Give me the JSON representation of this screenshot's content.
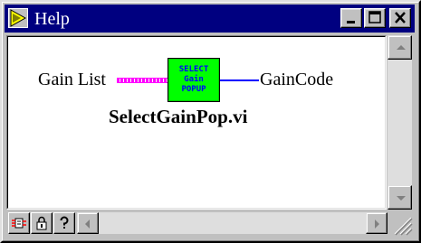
{
  "window": {
    "title": "Help"
  },
  "icons": {
    "app": "labview-arrow-icon",
    "minimize": "minimize-icon",
    "maximize": "maximize-icon",
    "close": "close-icon",
    "scroll_up": "arrow-up-icon",
    "scroll_down": "arrow-down-icon",
    "scroll_left": "arrow-left-icon",
    "scroll_right": "arrow-right-icon",
    "simple_complex": "diagram-view-icon",
    "lock": "lock-icon",
    "online_help": "question-icon",
    "resize_grip": "resize-grip-icon"
  },
  "diagram": {
    "input_label": "Gain List",
    "output_label": "GainCode",
    "vi_name": "SelectGainPop.vi",
    "vi_icon_lines": [
      "SELECT",
      "Gain",
      "POPUP"
    ]
  },
  "colors": {
    "titlebar": "#000080",
    "vi_icon_fill": "#00ff00",
    "vi_icon_text": "#0000ff",
    "input_wire": "#ff00ff",
    "output_wire": "#0000ff"
  }
}
